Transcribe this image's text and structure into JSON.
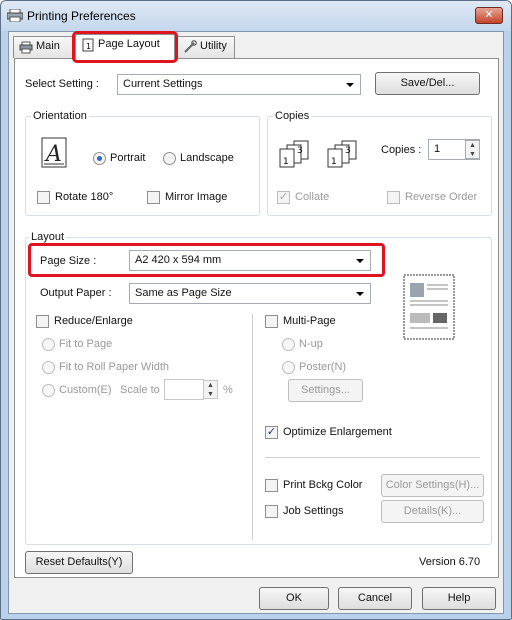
{
  "window": {
    "title": "Printing Preferences",
    "close_symbol": "✕"
  },
  "tabs": [
    {
      "label": "Main"
    },
    {
      "label": "Page Layout"
    },
    {
      "label": "Utility"
    }
  ],
  "select_setting": {
    "label": "Select Setting :",
    "value": "Current Settings",
    "save_del": "Save/Del..."
  },
  "orientation": {
    "title": "Orientation",
    "portrait": "Portrait",
    "landscape": "Landscape",
    "rotate": "Rotate 180°",
    "mirror": "Mirror Image",
    "selected": "Portrait"
  },
  "copies": {
    "title": "Copies",
    "label": "Copies :",
    "value": "1",
    "collate": "Collate",
    "reverse": "Reverse Order"
  },
  "layout": {
    "title": "Layout",
    "page_size_label": "Page Size :",
    "page_size_value": "A2 420 x 594 mm",
    "output_paper_label": "Output Paper :",
    "output_paper_value": "Same as Page Size",
    "reduce_enlarge": "Reduce/Enlarge",
    "fit_to_page": "Fit to Page",
    "fit_roll": "Fit to Roll Paper Width",
    "custom": "Custom(E)",
    "scale_to": "Scale to",
    "percent": "%",
    "multi_page": "Multi-Page",
    "n_up": "N-up",
    "poster": "Poster(N)",
    "settings_btn": "Settings...",
    "optimize": "Optimize Enlargement",
    "print_bckg": "Print Bckg Color",
    "color_settings": "Color Settings(H)...",
    "job_settings": "Job Settings",
    "details": "Details(K)..."
  },
  "footer": {
    "reset": "Reset Defaults(Y)",
    "version": "Version 6.70"
  },
  "bottom_buttons": {
    "ok": "OK",
    "cancel": "Cancel",
    "help": "Help"
  }
}
